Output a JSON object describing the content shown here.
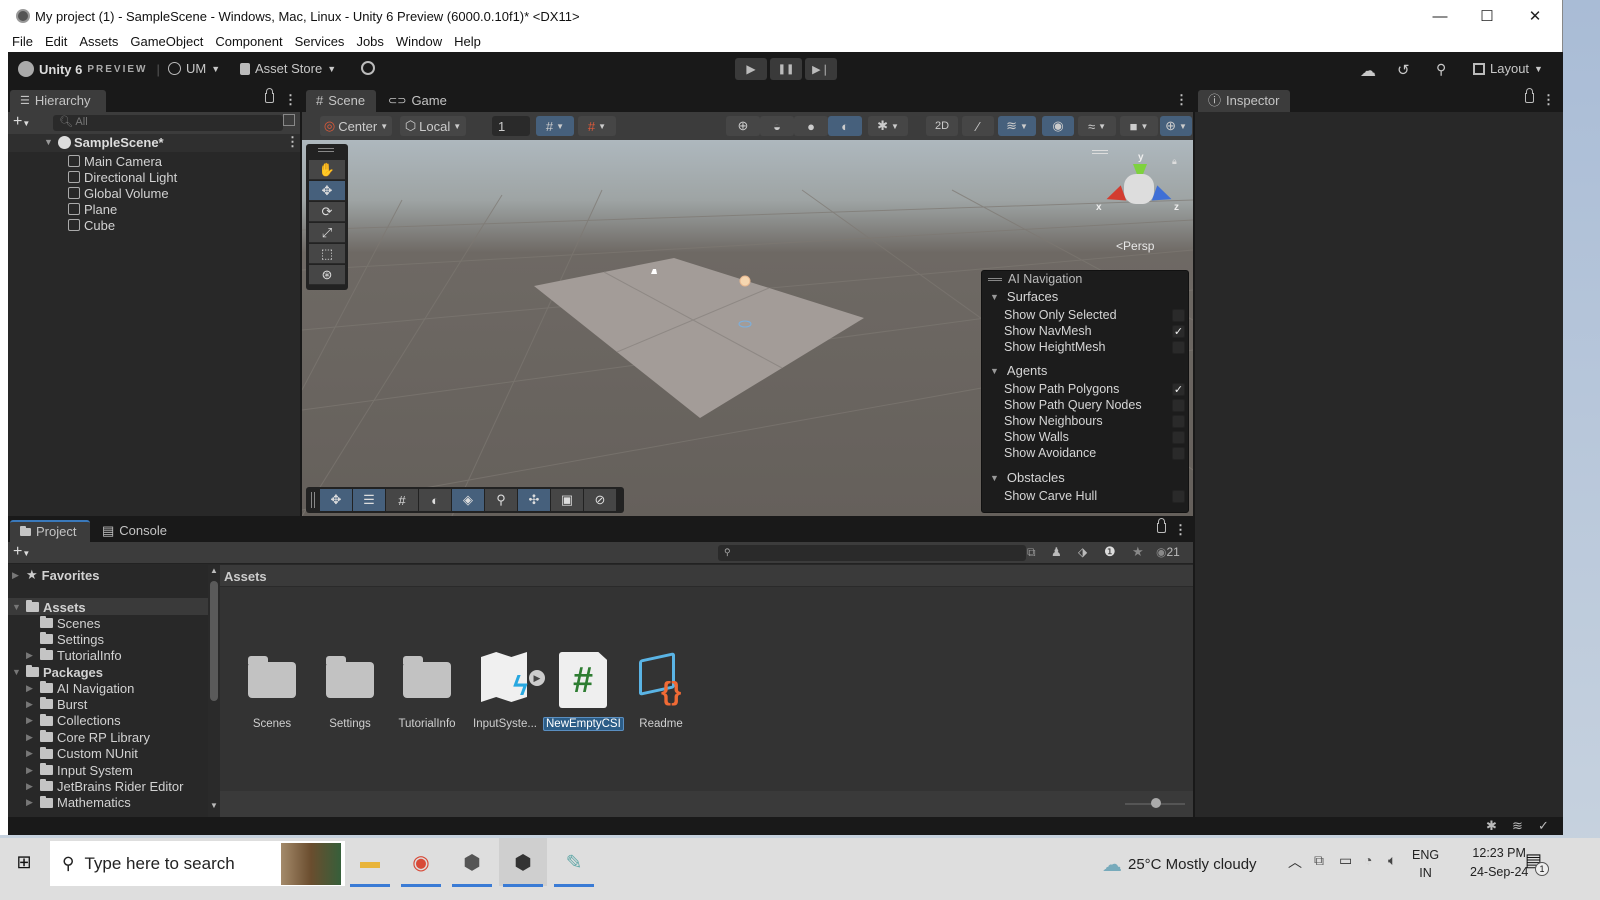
{
  "window": {
    "title": "My project (1) - SampleScene - Windows, Mac, Linux - Unity 6 Preview (6000.0.10f1)* <DX11>",
    "controls": {
      "minimize": "—",
      "maximize": "☐",
      "close": "✕"
    }
  },
  "menu": [
    "File",
    "Edit",
    "Assets",
    "GameObject",
    "Component",
    "Services",
    "Jobs",
    "Window",
    "Help"
  ],
  "toolbar": {
    "brand": "Unity 6",
    "brand_suffix": "PREVIEW",
    "account": "UM",
    "asset_store": "Asset Store",
    "layout": "Layout",
    "play": "▶",
    "pause": "❚❚",
    "step": "▶❘"
  },
  "hierarchy": {
    "tab": "Hierarchy",
    "search_placeholder": "All",
    "scene": "SampleScene*",
    "items": [
      "Main Camera",
      "Directional Light",
      "Global Volume",
      "Plane",
      "Cube"
    ]
  },
  "scene_view": {
    "tabs": [
      "Scene",
      "Game"
    ],
    "active_tab": "Scene",
    "pivot": "Center",
    "space": "Local",
    "grid_size": "1",
    "projection": "Persp",
    "axis_labels": {
      "x": "x",
      "y": "y",
      "z": "z"
    }
  },
  "ai_navigation": {
    "title": "AI Navigation",
    "sections": [
      {
        "name": "Surfaces",
        "items": [
          {
            "label": "Show Only Selected",
            "checked": false
          },
          {
            "label": "Show NavMesh",
            "checked": true
          },
          {
            "label": "Show HeightMesh",
            "checked": false
          }
        ]
      },
      {
        "name": "Agents",
        "items": [
          {
            "label": "Show Path Polygons",
            "checked": true
          },
          {
            "label": "Show Path Query Nodes",
            "checked": false
          },
          {
            "label": "Show Neighbours",
            "checked": false
          },
          {
            "label": "Show Walls",
            "checked": false
          },
          {
            "label": "Show Avoidance",
            "checked": false
          }
        ]
      },
      {
        "name": "Obstacles",
        "items": [
          {
            "label": "Show Carve Hull",
            "checked": false
          }
        ]
      }
    ]
  },
  "inspector": {
    "tab": "Inspector"
  },
  "project": {
    "tabs": [
      "Project",
      "Console"
    ],
    "hidden_count": "21",
    "favorites": "Favorites",
    "assets_root": "Assets",
    "assets_children": [
      "Scenes",
      "Settings",
      "TutorialInfo"
    ],
    "packages_root": "Packages",
    "packages": [
      "AI Navigation",
      "Burst",
      "Collections",
      "Core RP Library",
      "Custom NUnit",
      "Input System",
      "JetBrains Rider Editor",
      "Mathematics"
    ],
    "breadcrumb": "Assets",
    "grid": [
      {
        "name": "Scenes",
        "type": "folder"
      },
      {
        "name": "Settings",
        "type": "folder"
      },
      {
        "name": "TutorialInfo",
        "type": "folder"
      },
      {
        "name": "InputSyste...",
        "type": "input-actions"
      },
      {
        "name": "NewEmptyCSI",
        "type": "csharp",
        "selected": true
      },
      {
        "name": "Readme",
        "type": "readme"
      }
    ]
  },
  "taskbar": {
    "search_placeholder": "Type here to search",
    "weather": "25°C  Mostly cloudy",
    "lang1": "ENG",
    "lang2": "IN",
    "time": "12:23 PM",
    "date": "24-Sep-24",
    "notifications": "1"
  },
  "colors": {
    "accent": "#46607c",
    "selection": "#2c5d87",
    "csharp_green": "#2e7d32",
    "readme_blue": "#5ab4e5",
    "readme_orange": "#f06a35"
  }
}
